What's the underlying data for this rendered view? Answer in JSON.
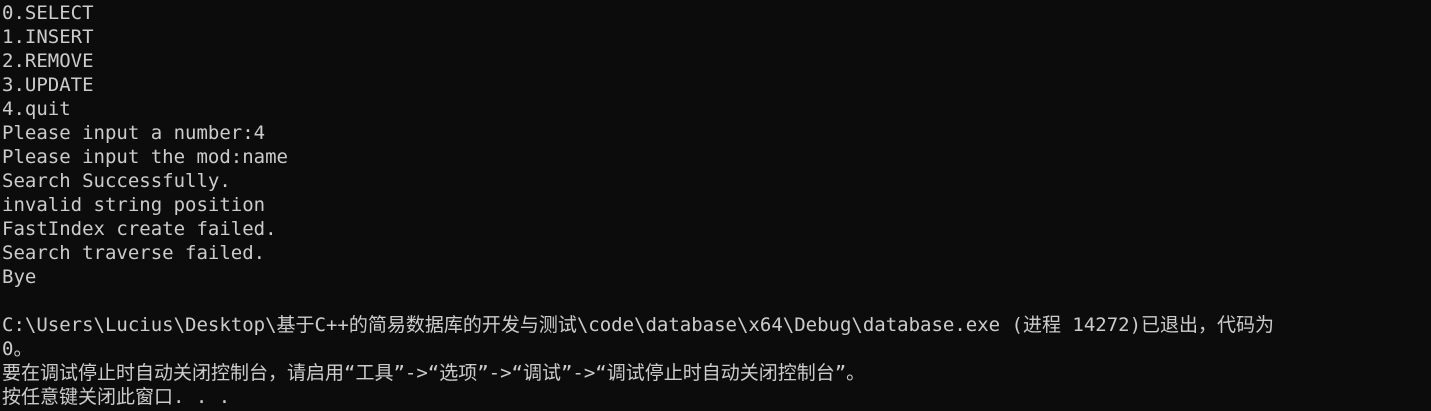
{
  "console": {
    "menu": [
      "0.SELECT",
      "1.INSERT",
      "2.REMOVE",
      "3.UPDATE",
      "4.quit"
    ],
    "prompt_number": "Please input a number:4",
    "prompt_mod": "Please input the mod:name",
    "messages": [
      "Search Successfully.",
      "invalid string position",
      "FastIndex create failed.",
      "Search traverse failed.",
      "Bye"
    ],
    "exit_line_1": "C:\\Users\\Lucius\\Desktop\\基于C++的简易数据库的开发与测试\\code\\database\\x64\\Debug\\database.exe (进程 14272)已退出，代码为",
    "exit_line_2": "0。",
    "hint_line": "要在调试停止时自动关闭控制台，请启用“工具”->“选项”->“调试”->“调试停止时自动关闭控制台”。",
    "press_key_line": "按任意键关闭此窗口. . ."
  }
}
